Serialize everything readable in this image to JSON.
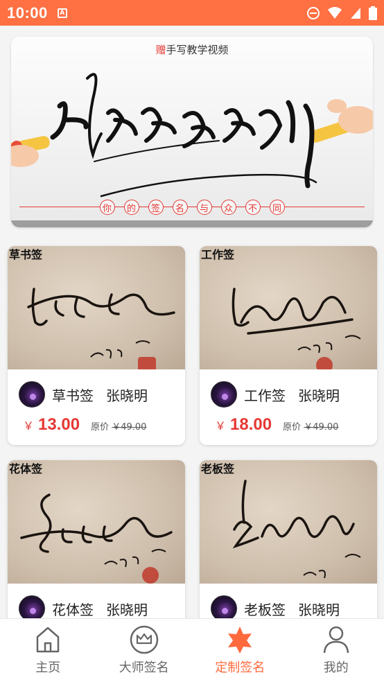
{
  "status_bar": {
    "time": "10:00",
    "notification_badge": "A"
  },
  "banner": {
    "top_prefix": "赠",
    "top_text": "手写教学视频",
    "calligraphy_title": "炫酷签名定制",
    "slogan": [
      "你",
      "的",
      "签",
      "名",
      "与",
      "众",
      "不",
      "同"
    ]
  },
  "products": [
    {
      "image_label": "草书签",
      "style": "草书签",
      "name": "张晓明",
      "currency": "￥",
      "price": "13.00",
      "original_label": "原价",
      "original_price": "￥49.00"
    },
    {
      "image_label": "工作签",
      "style": "工作签",
      "name": "张晓明",
      "currency": "￥",
      "price": "18.00",
      "original_label": "原价",
      "original_price": "￥49.00"
    },
    {
      "image_label": "花体签",
      "style": "花体签",
      "name": "张晓明"
    },
    {
      "image_label": "老板签",
      "style": "老板签",
      "name": "张晓明"
    }
  ],
  "bottom_nav": [
    {
      "label": "主页",
      "icon": "home-icon",
      "active": false
    },
    {
      "label": "大师签名",
      "icon": "crown-icon",
      "active": false
    },
    {
      "label": "定制签名",
      "icon": "star-icon",
      "active": true
    },
    {
      "label": "我的",
      "icon": "profile-icon",
      "active": false
    }
  ],
  "colors": {
    "accent": "#ff6a3d",
    "status_bar": "#ff7043",
    "price": "#e53935",
    "inactive_nav": "#666666"
  }
}
